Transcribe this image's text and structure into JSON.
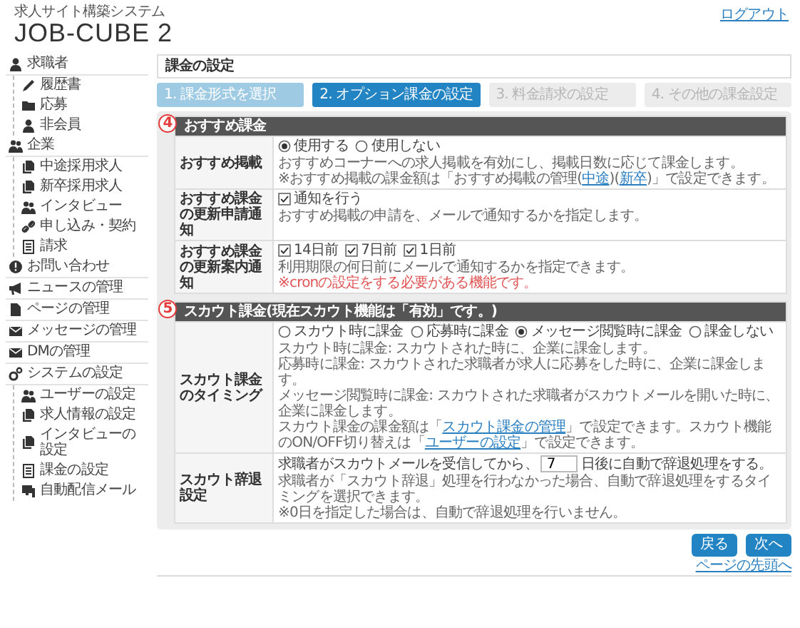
{
  "header": {
    "subtitle": "求人サイト構築システム",
    "title": "JOB-CUBE 2",
    "logout": "ログアウト"
  },
  "sidebar": {
    "items": [
      {
        "label": "求職者",
        "children": [
          {
            "label": "履歴書"
          },
          {
            "label": "応募"
          },
          {
            "label": "非会員"
          }
        ]
      },
      {
        "label": "企業",
        "children": [
          {
            "label": "中途採用求人"
          },
          {
            "label": "新卒採用求人"
          },
          {
            "label": "インタビュー"
          },
          {
            "label": "申し込み・契約"
          },
          {
            "label": "請求"
          }
        ]
      },
      {
        "label": "お問い合わせ"
      },
      {
        "label": "ニュースの管理"
      },
      {
        "label": "ページの管理"
      },
      {
        "label": "メッセージの管理"
      },
      {
        "label": "DMの管理"
      },
      {
        "label": "システムの設定",
        "children": [
          {
            "label": "ユーザーの設定"
          },
          {
            "label": "求人情報の設定"
          },
          {
            "label": "インタビューの設定"
          },
          {
            "label": "課金の設定"
          },
          {
            "label": "自動配信メール"
          }
        ]
      }
    ]
  },
  "page_title": "課金の設定",
  "steps": [
    {
      "label": "1. 課金形式を選択",
      "selected": false,
      "completed": true
    },
    {
      "label": "2. オプション課金の設定",
      "selected": true,
      "completed": false
    },
    {
      "label": "3. 料金請求の設定",
      "selected": false,
      "completed": false
    },
    {
      "label": "4. その他の課金設定",
      "selected": false,
      "completed": false
    }
  ],
  "sections": [
    {
      "badge": "4",
      "title": "おすすめ課金",
      "rows": [
        {
          "label": "おすすめ掲載",
          "kind": "radio",
          "options": [
            {
              "label": "使用する",
              "selected": true
            },
            {
              "label": "使用しない",
              "selected": false
            }
          ],
          "notes": [
            [
              {
                "text": "おすすめコーナーへの求人掲載を有効にし、掲載日数に応じて課金します。"
              }
            ],
            [
              {
                "text": "※おすすめ掲載の課金額は「おすすめ掲載の管理("
              },
              {
                "text": "中途",
                "link": true
              },
              {
                "text": ")("
              },
              {
                "text": "新卒",
                "link": true
              },
              {
                "text": ")」で設定できます。"
              }
            ]
          ]
        },
        {
          "label": "おすすめ課金の更新申請通知",
          "kind": "checkbox",
          "options": [
            {
              "label": "通知を行う",
              "checked": true
            }
          ],
          "notes": [
            [
              {
                "text": "おすすめ掲載の申請を、メールで通知するかを指定します。"
              }
            ]
          ]
        },
        {
          "label": "おすすめ課金の更新案内通知",
          "kind": "checkbox",
          "options": [
            {
              "label": "14日前",
              "checked": true
            },
            {
              "label": "7日前",
              "checked": true
            },
            {
              "label": "1日前",
              "checked": true
            }
          ],
          "notes": [
            [
              {
                "text": "利用期限の何日前にメールで通知するかを指定できます。"
              }
            ],
            [
              {
                "text": "※cronの設定をする必要がある機能です。",
                "warning": true
              }
            ]
          ]
        }
      ]
    },
    {
      "badge": "5",
      "title": "スカウト課金(現在スカウト機能は「有効」です。)",
      "rows": [
        {
          "label": "スカウト課金のタイミング",
          "kind": "radio",
          "options": [
            {
              "label": "スカウト時に課金",
              "selected": false
            },
            {
              "label": "応募時に課金",
              "selected": false
            },
            {
              "label": "メッセージ閲覧時に課金",
              "selected": true
            },
            {
              "label": "課金しない",
              "selected": false
            }
          ],
          "notes": [
            [
              {
                "text": "スカウト時に課金: スカウトされた時に、企業に課金します。"
              }
            ],
            [
              {
                "text": "応募時に課金: スカウトされた求職者が求人に応募をした時に、企業に課金します。"
              }
            ],
            [
              {
                "text": "メッセージ閲覧時に課金: スカウトされた求職者がスカウトメールを開いた時に、企業に課金します。"
              }
            ],
            [
              {
                "text": "スカウト課金の課金額は「"
              },
              {
                "text": "スカウト課金の管理",
                "link": true
              },
              {
                "text": "」で設定できます。スカウト機能のON/OFF切り替えは「"
              },
              {
                "text": "ユーザーの設定",
                "link": true
              },
              {
                "text": "」で設定できます。"
              }
            ]
          ]
        },
        {
          "label": "スカウト辞退設定",
          "kind": "number_input",
          "before": "求職者がスカウトメールを受信してから、",
          "value": "7",
          "after": "日後に自動で辞退処理をする。",
          "notes": [
            [
              {
                "text": "求職者が「スカウト辞退」処理を行わなかった場合、自動で辞退処理をするタイミングを選択できます。"
              }
            ],
            [
              {
                "text": "※0日を指定した場合は、自動で辞退処理を行いません。"
              }
            ]
          ]
        }
      ]
    }
  ],
  "buttons": [
    {
      "label": "戻る"
    },
    {
      "label": "次へ"
    }
  ],
  "footer_link": "ページの先頭へ"
}
